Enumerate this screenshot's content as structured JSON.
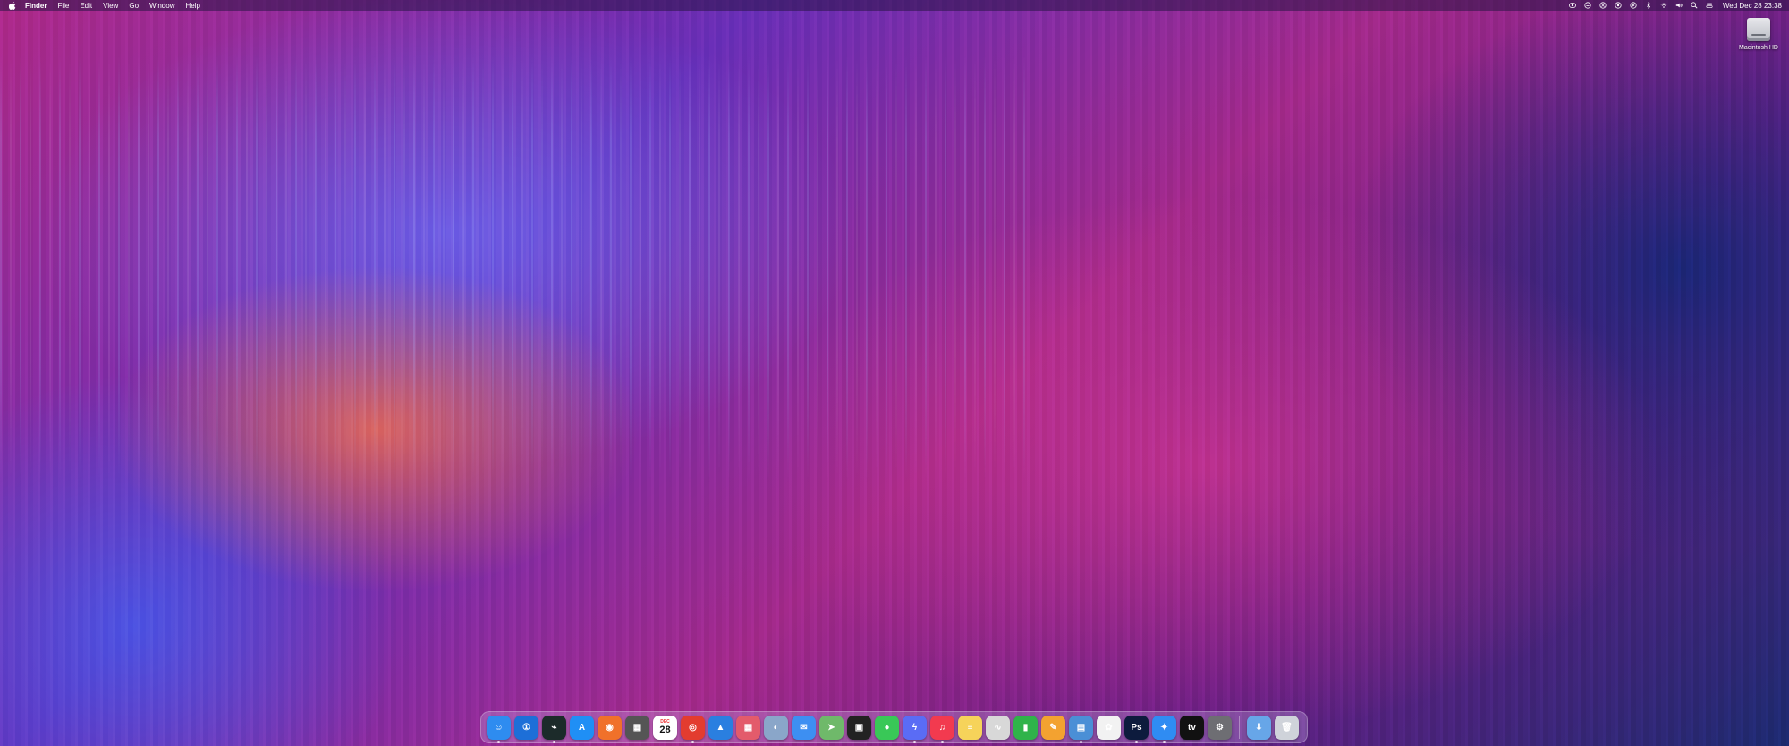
{
  "menubar": {
    "apple_icon": "apple-icon",
    "app_name": "Finder",
    "menus": [
      "File",
      "Edit",
      "View",
      "Go",
      "Window",
      "Help"
    ],
    "status_icons": [
      "screen-share-icon",
      "creative-cloud-icon",
      "vpn-icon",
      "focus-icon",
      "play-icon",
      "bluetooth-icon",
      "wifi-icon",
      "volume-icon",
      "search-icon",
      "control-center-icon"
    ],
    "clock": "Wed Dec 28  23:38"
  },
  "desktop": {
    "drive_label": "Macintosh HD"
  },
  "dock": {
    "apps": [
      {
        "name": "finder",
        "glyph": "☺",
        "color": "#2e8cf0",
        "running": true
      },
      {
        "name": "1password",
        "glyph": "①",
        "color": "#1d6fd8",
        "running": false
      },
      {
        "name": "activity-monitor",
        "glyph": "⌁",
        "color": "#1c2b2a",
        "running": true
      },
      {
        "name": "app-store",
        "glyph": "A",
        "color": "#1f8ff5",
        "running": false
      },
      {
        "name": "firefox",
        "glyph": "◉",
        "color": "#f0712a",
        "running": false
      },
      {
        "name": "calculator",
        "glyph": "▦",
        "color": "#555555",
        "running": false
      },
      {
        "name": "calendar",
        "glyph": "28",
        "month": "DEC",
        "color": "#ffffff",
        "running": false
      },
      {
        "name": "chrome",
        "glyph": "◎",
        "color": "#e33c2f",
        "running": true
      },
      {
        "name": "keynote",
        "glyph": "▲",
        "color": "#2a7fe0",
        "running": false
      },
      {
        "name": "launchpad",
        "glyph": "▦",
        "color": "#e35b6b",
        "running": false
      },
      {
        "name": "macos-installer",
        "glyph": "◐",
        "color": "#8aa6c9",
        "running": false
      },
      {
        "name": "mail",
        "glyph": "✉",
        "color": "#3d8ff2",
        "running": false
      },
      {
        "name": "maps",
        "glyph": "➤",
        "color": "#6fb96a",
        "running": false
      },
      {
        "name": "mission-control",
        "glyph": "▣",
        "color": "#222222",
        "running": false
      },
      {
        "name": "messages",
        "glyph": "●",
        "color": "#39c857",
        "running": false
      },
      {
        "name": "messenger",
        "glyph": "ϟ",
        "color": "#5a6cf5",
        "running": true
      },
      {
        "name": "music",
        "glyph": "♫",
        "color": "#f23a4f",
        "running": true
      },
      {
        "name": "notes",
        "glyph": "≡",
        "color": "#f6d35a",
        "running": false
      },
      {
        "name": "activity-graph",
        "glyph": "∿",
        "color": "#d8d8d8",
        "running": false
      },
      {
        "name": "numbers",
        "glyph": "▮",
        "color": "#2fb34a",
        "running": false
      },
      {
        "name": "pages",
        "glyph": "✎",
        "color": "#f3a230",
        "running": false
      },
      {
        "name": "preview",
        "glyph": "▤",
        "color": "#4a8fd6",
        "running": true
      },
      {
        "name": "photos",
        "glyph": "✿",
        "color": "#f2f2f2",
        "running": false
      },
      {
        "name": "photoshop",
        "glyph": "Ps",
        "color": "#0d1b3d",
        "running": true
      },
      {
        "name": "safari",
        "glyph": "✦",
        "color": "#2f8cf3",
        "running": true
      },
      {
        "name": "apple-tv",
        "glyph": "tv",
        "color": "#111111",
        "running": false
      },
      {
        "name": "system-settings",
        "glyph": "⚙",
        "color": "#6e6e73",
        "running": false
      }
    ],
    "right_items": [
      {
        "name": "downloads-folder",
        "glyph": "⬇",
        "color": "#67a6e8"
      },
      {
        "name": "trash",
        "glyph": "🗑",
        "color": "#cfd3da"
      }
    ]
  }
}
